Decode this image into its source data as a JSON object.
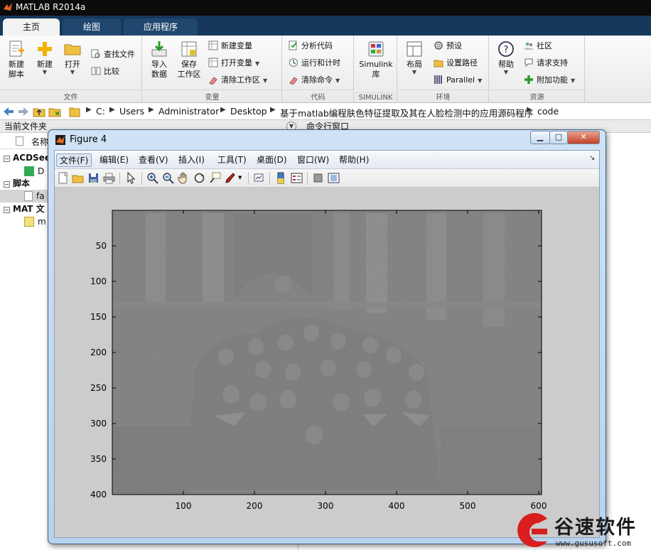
{
  "app": {
    "title": "MATLAB R2014a"
  },
  "tabs": [
    {
      "label": "主页"
    },
    {
      "label": "绘图"
    },
    {
      "label": "应用程序"
    }
  ],
  "ribbon": {
    "file": {
      "section": "文件",
      "new_script": "新建\n脚本",
      "new": "新建",
      "open": "打开",
      "find_files": "查找文件",
      "compare": "比较"
    },
    "variable": {
      "section": "变量",
      "import": "导入\n数据",
      "save_ws": "保存\n工作区",
      "new_var": "新建变量",
      "open_var": "打开变量",
      "clear_ws": "清除工作区"
    },
    "code": {
      "section": "代码",
      "analyze": "分析代码",
      "run_time": "运行和计时",
      "clear_cmd": "清除命令"
    },
    "simulink": {
      "section": "SIMULINK",
      "label": "Simulink\n库"
    },
    "env": {
      "section": "环境",
      "layout": "布局",
      "prefs": "预设",
      "set_path": "设置路径",
      "parallel": "Parallel"
    },
    "resources": {
      "section": "资源",
      "help": "帮助",
      "community": "社区",
      "support": "请求支持",
      "addons": "附加功能"
    }
  },
  "address": {
    "crumbs": [
      "C:",
      "Users",
      "Administrator",
      "Desktop",
      "基于matlab编程肤色特征提取及其在人脸检测中的应用源码程序",
      "code"
    ]
  },
  "left_panel": {
    "title": "当前文件夹",
    "col_name": "名称",
    "rows": [
      {
        "group": "ACDSee"
      },
      {
        "file": "D"
      },
      {
        "group": "脚本"
      },
      {
        "file": "fa"
      },
      {
        "group": "MAT 文"
      },
      {
        "file": "m"
      }
    ]
  },
  "right_panel": {
    "title": "命令行窗口"
  },
  "figure": {
    "title": "Figure 4",
    "menus": [
      "文件(F)",
      "编辑(E)",
      "查看(V)",
      "插入(I)",
      "工具(T)",
      "桌面(D)",
      "窗口(W)",
      "帮助(H)"
    ]
  },
  "axes": {
    "y_ticks": [
      "50",
      "100",
      "150",
      "200",
      "250",
      "300",
      "350",
      "400"
    ],
    "x_ticks": [
      "100",
      "200",
      "300",
      "400",
      "500",
      "600"
    ]
  },
  "watermark": {
    "text": "谷速软件",
    "url": "www.gususoft.com"
  }
}
